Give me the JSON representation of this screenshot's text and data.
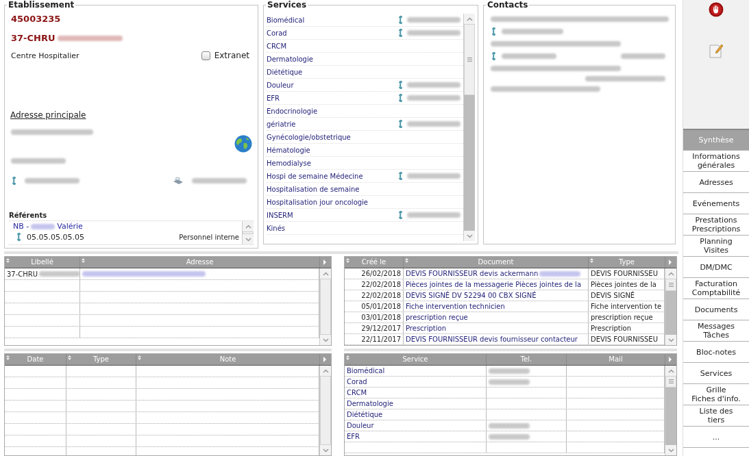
{
  "establishment": {
    "title": "Etablissement",
    "code": "45003235",
    "name": "37-CHRU",
    "category": "Centre Hospitalier",
    "extranet": {
      "label": "Extranet",
      "checked": false
    },
    "address_link": "Adresse principale",
    "referents": {
      "title": "Référents",
      "items": [
        {
          "prefix": "NB -",
          "first_name": "Valérie",
          "phone": "05.05.05.05.05",
          "role": "Personnel interne"
        }
      ]
    }
  },
  "services": {
    "title": "Services",
    "items": [
      {
        "name": "Biomédical",
        "phone": true
      },
      {
        "name": "Corad",
        "phone": true
      },
      {
        "name": "CRCM",
        "phone": false
      },
      {
        "name": "Dermatologie",
        "phone": false
      },
      {
        "name": "Diététique",
        "phone": false
      },
      {
        "name": "Douleur",
        "phone": true
      },
      {
        "name": "EFR",
        "phone": true
      },
      {
        "name": "Endocrinologie",
        "phone": false
      },
      {
        "name": "gériatrie",
        "phone": true
      },
      {
        "name": "Gynécologie/obstetrique",
        "phone": false
      },
      {
        "name": "Hématologie",
        "phone": false
      },
      {
        "name": "Hemodialyse",
        "phone": false
      },
      {
        "name": "Hospi de semaine Médecine",
        "phone": true
      },
      {
        "name": "Hospitalisation de semaine",
        "phone": false
      },
      {
        "name": "Hospitalisation jour oncologie",
        "phone": false
      },
      {
        "name": "INSERM",
        "phone": true
      },
      {
        "name": "Kinés",
        "phone": false
      }
    ]
  },
  "contacts": {
    "title": "Contacts"
  },
  "addresses_table": {
    "columns": [
      {
        "label": "Libellé",
        "sortable": true,
        "kind": "text"
      },
      {
        "label": "Adresse",
        "sortable": true,
        "kind": "link"
      }
    ],
    "rows": [
      {
        "cells": [
          {
            "text": "37-CHRU",
            "blurred": true
          },
          {
            "blurred": true
          }
        ]
      }
    ]
  },
  "notes_table": {
    "columns": [
      {
        "label": "Date",
        "sortable": true
      },
      {
        "label": "Type",
        "sortable": true
      },
      {
        "label": "Note",
        "sortable": true
      }
    ]
  },
  "documents_table": {
    "columns": [
      {
        "label": "Créé le",
        "sortable": true,
        "kind": "date"
      },
      {
        "label": "Document",
        "sortable": true,
        "kind": "link"
      },
      {
        "label": "Type",
        "sortable": true,
        "kind": "text"
      }
    ],
    "rows": [
      {
        "cells": [
          {
            "text": "26/02/2018"
          },
          {
            "text": "DEVIS FOURNISSEUR devis ackermann",
            "blurred": true
          },
          {
            "text": "DEVIS FOURNISSEU"
          }
        ]
      },
      {
        "cells": [
          {
            "text": "22/02/2018"
          },
          {
            "text": "Pièces jointes de la messagerie Pièces jointes de la"
          },
          {
            "text": "Pièces jointes de la"
          }
        ]
      },
      {
        "cells": [
          {
            "text": "22/02/2018"
          },
          {
            "text": "DEVIS SIGNÉ DV 52294 00 CBX SIGNÉ"
          },
          {
            "text": "DEVIS SIGNÉ"
          }
        ]
      },
      {
        "cells": [
          {
            "text": "05/01/2018"
          },
          {
            "text": "Fiche intervention technicien"
          },
          {
            "text": "Fiche intervention te"
          }
        ]
      },
      {
        "cells": [
          {
            "text": "03/01/2018"
          },
          {
            "text": "prescription reçue"
          },
          {
            "text": "prescription reçue"
          }
        ]
      },
      {
        "cells": [
          {
            "text": "29/12/2017"
          },
          {
            "text": "Prescription"
          },
          {
            "text": "Prescription"
          }
        ]
      },
      {
        "cells": [
          {
            "text": "22/11/2017"
          },
          {
            "text": "DEVIS FOURNISSEUR devis fournisseur contacteur"
          },
          {
            "text": "DEVIS FOURNISSEU"
          }
        ]
      }
    ]
  },
  "services_table": {
    "columns": [
      {
        "label": "Service",
        "sortable": true,
        "kind": "link"
      },
      {
        "label": "Tel.",
        "sortable": false,
        "kind": "text"
      },
      {
        "label": "Mail",
        "sortable": false,
        "kind": "text"
      }
    ],
    "rows": [
      {
        "cells": [
          {
            "text": "Biomédical"
          },
          {
            "blurred": true
          }
        ]
      },
      {
        "cells": [
          {
            "text": "Corad"
          },
          {
            "blurred": true
          }
        ]
      },
      {
        "cells": [
          {
            "text": "CRCM"
          }
        ]
      },
      {
        "cells": [
          {
            "text": "Dermatologie"
          }
        ]
      },
      {
        "cells": [
          {
            "text": "Diététique"
          }
        ]
      },
      {
        "cells": [
          {
            "text": "Douleur"
          },
          {
            "blurred": true
          }
        ]
      },
      {
        "cells": [
          {
            "text": "EFR"
          },
          {
            "blurred": true
          }
        ]
      }
    ]
  },
  "tabs": [
    {
      "label": "Synthèse",
      "selected": true
    },
    {
      "label": "Informations\ngénérales",
      "selected": false
    },
    {
      "label": "Adresses",
      "selected": false
    },
    {
      "label": "Evénements",
      "selected": false
    },
    {
      "label": "Prestations\nPrescriptions",
      "selected": false
    },
    {
      "label": "Planning\nVisites",
      "selected": false
    },
    {
      "label": "DM/DMC",
      "selected": false
    },
    {
      "label": "Facturation\nComptabilité",
      "selected": false
    },
    {
      "label": "Documents",
      "selected": false
    },
    {
      "label": "Messages\nTâches",
      "selected": false
    },
    {
      "label": "Bloc-notes",
      "selected": false
    },
    {
      "label": "Services",
      "selected": false
    },
    {
      "label": "Grille\nFiches d'info.",
      "selected": false
    },
    {
      "label": "Liste des\ntiers",
      "selected": false
    },
    {
      "label": "...",
      "selected": false
    }
  ]
}
